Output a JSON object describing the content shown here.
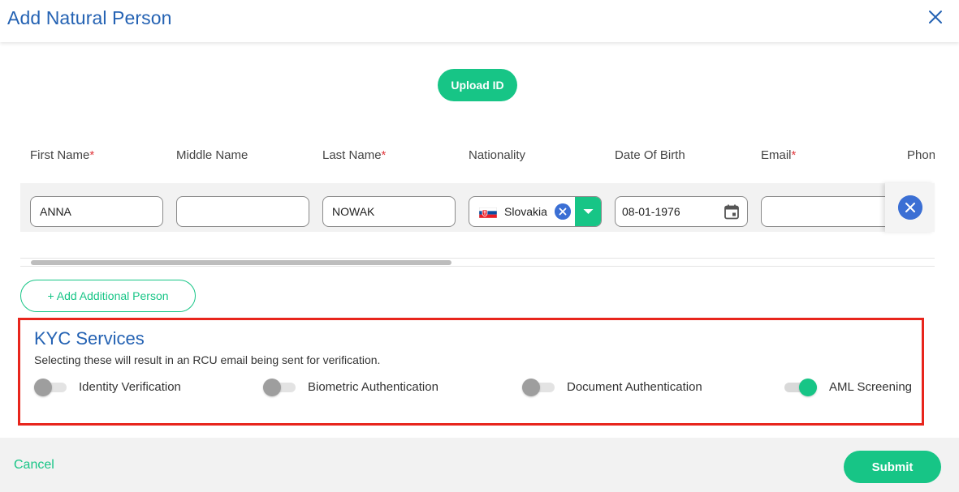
{
  "dialog": {
    "title": "Add Natural Person"
  },
  "upload": {
    "label": "Upload ID"
  },
  "table": {
    "columns": [
      {
        "label": "First Name",
        "required": "*"
      },
      {
        "label": "Middle Name",
        "required": ""
      },
      {
        "label": "Last Name",
        "required": "*"
      },
      {
        "label": "Nationality",
        "required": ""
      },
      {
        "label": "Date Of Birth",
        "required": ""
      },
      {
        "label": "Email",
        "required": "*"
      },
      {
        "label": "Phon",
        "required": ""
      }
    ],
    "row": {
      "first_name": "ANNA",
      "middle_name": "",
      "last_name": "NOWAK",
      "nationality": "Slovakia",
      "date_of_birth": "08-01-1976",
      "email": ""
    }
  },
  "add_person": {
    "label": "+ Add Additional Person"
  },
  "kyc": {
    "title": "KYC Services",
    "subtitle": "Selecting these will result in an RCU email being sent for verification.",
    "services": [
      {
        "label": "Identity Verification",
        "enabled": false
      },
      {
        "label": "Biometric Authentication",
        "enabled": false
      },
      {
        "label": "Document Authentication",
        "enabled": false
      },
      {
        "label": "AML Screening",
        "enabled": true
      }
    ]
  },
  "footer": {
    "cancel_label": "Cancel",
    "submit_label": "Submit"
  },
  "colors": {
    "accent": "#17c586",
    "title_blue": "#2462b3",
    "highlight_red": "#e8251c",
    "icon_blue": "#3b6fd4"
  }
}
